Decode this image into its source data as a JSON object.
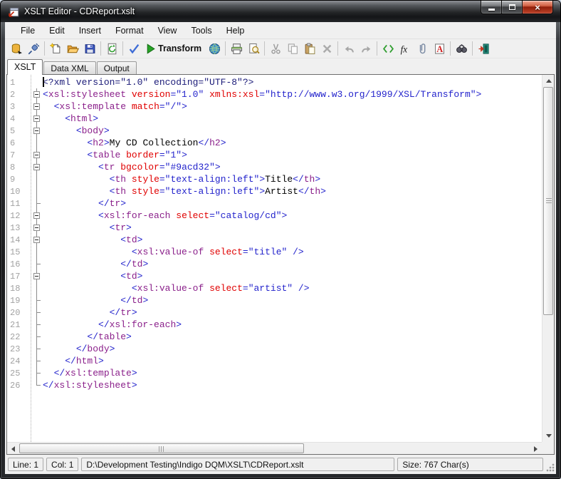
{
  "window": {
    "title": "XSLT Editor - CDReport.xslt"
  },
  "titlebar_buttons": [
    "minimize",
    "maximize",
    "close"
  ],
  "menu": {
    "items": [
      "File",
      "Edit",
      "Insert",
      "Format",
      "View",
      "Tools",
      "Help"
    ]
  },
  "toolbar": {
    "groups": [
      [
        {
          "name": "database-export"
        },
        {
          "name": "connect"
        }
      ],
      [
        {
          "name": "new-document"
        },
        {
          "name": "open-folder"
        },
        {
          "name": "save"
        }
      ],
      [
        {
          "name": "refresh"
        }
      ],
      [
        {
          "name": "validate"
        },
        {
          "name": "transform",
          "label": "Transform"
        },
        {
          "name": "browser-globe"
        }
      ],
      [
        {
          "name": "print"
        },
        {
          "name": "print-preview"
        }
      ],
      [
        {
          "name": "cut",
          "disabled": true
        },
        {
          "name": "copy",
          "disabled": true
        },
        {
          "name": "paste"
        },
        {
          "name": "delete",
          "disabled": true
        }
      ],
      [
        {
          "name": "undo",
          "disabled": true
        },
        {
          "name": "redo",
          "disabled": true
        }
      ],
      [
        {
          "name": "code-tags"
        },
        {
          "name": "function"
        },
        {
          "name": "attachment"
        },
        {
          "name": "font"
        }
      ],
      [
        {
          "name": "find"
        }
      ],
      [
        {
          "name": "exit"
        }
      ]
    ]
  },
  "tabs": [
    {
      "label": "XSLT",
      "active": true
    },
    {
      "label": "Data XML",
      "active": false
    },
    {
      "label": "Output",
      "active": false
    }
  ],
  "colors": {
    "i": "#1b1b78",
    "d": "#2323cc",
    "t": "#8a1f8a",
    "a": "#e00000",
    "v": "#2323cc",
    "x": "#000000"
  },
  "editor": {
    "lines": [
      {
        "n": 1,
        "f": "",
        "s": [
          [
            "<?xml version=\"1.0\" encoding=\"UTF-8\"?>",
            "i"
          ]
        ]
      },
      {
        "n": 2,
        "f": "b",
        "s": [
          [
            "<",
            "d"
          ],
          [
            "xsl:stylesheet",
            "t"
          ],
          [
            " ",
            "x"
          ],
          [
            "version",
            "a"
          ],
          [
            "=\"1.0\"",
            "v"
          ],
          [
            " ",
            "x"
          ],
          [
            "xmlns:xsl",
            "a"
          ],
          [
            "=\"http://www.w3.org/1999/XSL/Transform\"",
            "v"
          ],
          [
            ">",
            "d"
          ]
        ]
      },
      {
        "n": 3,
        "f": "b",
        "s": [
          [
            "  ",
            "x"
          ],
          [
            "<",
            "d"
          ],
          [
            "xsl:template",
            "t"
          ],
          [
            " ",
            "x"
          ],
          [
            "match",
            "a"
          ],
          [
            "=\"/\"",
            "v"
          ],
          [
            ">",
            "d"
          ]
        ]
      },
      {
        "n": 4,
        "f": "b",
        "s": [
          [
            "    ",
            "x"
          ],
          [
            "<",
            "d"
          ],
          [
            "html",
            "t"
          ],
          [
            ">",
            "d"
          ]
        ]
      },
      {
        "n": 5,
        "f": "b",
        "s": [
          [
            "      ",
            "x"
          ],
          [
            "<",
            "d"
          ],
          [
            "body",
            "t"
          ],
          [
            ">",
            "d"
          ]
        ]
      },
      {
        "n": 6,
        "f": "",
        "s": [
          [
            "        ",
            "x"
          ],
          [
            "<",
            "d"
          ],
          [
            "h2",
            "t"
          ],
          [
            ">",
            "d"
          ],
          [
            "My CD Collection",
            "x"
          ],
          [
            "</",
            "d"
          ],
          [
            "h2",
            "t"
          ],
          [
            ">",
            "d"
          ]
        ]
      },
      {
        "n": 7,
        "f": "b",
        "s": [
          [
            "        ",
            "x"
          ],
          [
            "<",
            "d"
          ],
          [
            "table",
            "t"
          ],
          [
            " ",
            "x"
          ],
          [
            "border",
            "a"
          ],
          [
            "=\"1\"",
            "v"
          ],
          [
            ">",
            "d"
          ]
        ]
      },
      {
        "n": 8,
        "f": "b",
        "s": [
          [
            "          ",
            "x"
          ],
          [
            "<",
            "d"
          ],
          [
            "tr",
            "t"
          ],
          [
            " ",
            "x"
          ],
          [
            "bgcolor",
            "a"
          ],
          [
            "=\"#9acd32\"",
            "v"
          ],
          [
            ">",
            "d"
          ]
        ]
      },
      {
        "n": 9,
        "f": "",
        "s": [
          [
            "            ",
            "x"
          ],
          [
            "<",
            "d"
          ],
          [
            "th",
            "t"
          ],
          [
            " ",
            "x"
          ],
          [
            "style",
            "a"
          ],
          [
            "=\"text-align:left\"",
            "v"
          ],
          [
            ">",
            "d"
          ],
          [
            "Title",
            "x"
          ],
          [
            "</",
            "d"
          ],
          [
            "th",
            "t"
          ],
          [
            ">",
            "d"
          ]
        ]
      },
      {
        "n": 10,
        "f": "",
        "s": [
          [
            "            ",
            "x"
          ],
          [
            "<",
            "d"
          ],
          [
            "th",
            "t"
          ],
          [
            " ",
            "x"
          ],
          [
            "style",
            "a"
          ],
          [
            "=\"text-align:left\"",
            "v"
          ],
          [
            ">",
            "d"
          ],
          [
            "Artist",
            "x"
          ],
          [
            "</",
            "d"
          ],
          [
            "th",
            "t"
          ],
          [
            ">",
            "d"
          ]
        ]
      },
      {
        "n": 11,
        "f": "t",
        "s": [
          [
            "          ",
            "x"
          ],
          [
            "</",
            "d"
          ],
          [
            "tr",
            "t"
          ],
          [
            ">",
            "d"
          ]
        ]
      },
      {
        "n": 12,
        "f": "b",
        "s": [
          [
            "          ",
            "x"
          ],
          [
            "<",
            "d"
          ],
          [
            "xsl:for-each",
            "t"
          ],
          [
            " ",
            "x"
          ],
          [
            "select",
            "a"
          ],
          [
            "=\"catalog/cd\"",
            "v"
          ],
          [
            ">",
            "d"
          ]
        ]
      },
      {
        "n": 13,
        "f": "b",
        "s": [
          [
            "            ",
            "x"
          ],
          [
            "<",
            "d"
          ],
          [
            "tr",
            "t"
          ],
          [
            ">",
            "d"
          ]
        ]
      },
      {
        "n": 14,
        "f": "b",
        "s": [
          [
            "              ",
            "x"
          ],
          [
            "<",
            "d"
          ],
          [
            "td",
            "t"
          ],
          [
            ">",
            "d"
          ]
        ]
      },
      {
        "n": 15,
        "f": "",
        "s": [
          [
            "                ",
            "x"
          ],
          [
            "<",
            "d"
          ],
          [
            "xsl:value-of",
            "t"
          ],
          [
            " ",
            "x"
          ],
          [
            "select",
            "a"
          ],
          [
            "=\"title\"",
            "v"
          ],
          [
            " ",
            "x"
          ],
          [
            "/>",
            "d"
          ]
        ]
      },
      {
        "n": 16,
        "f": "t",
        "s": [
          [
            "              ",
            "x"
          ],
          [
            "</",
            "d"
          ],
          [
            "td",
            "t"
          ],
          [
            ">",
            "d"
          ]
        ]
      },
      {
        "n": 17,
        "f": "b",
        "s": [
          [
            "              ",
            "x"
          ],
          [
            "<",
            "d"
          ],
          [
            "td",
            "t"
          ],
          [
            ">",
            "d"
          ]
        ]
      },
      {
        "n": 18,
        "f": "",
        "s": [
          [
            "                ",
            "x"
          ],
          [
            "<",
            "d"
          ],
          [
            "xsl:value-of",
            "t"
          ],
          [
            " ",
            "x"
          ],
          [
            "select",
            "a"
          ],
          [
            "=\"artist\"",
            "v"
          ],
          [
            " ",
            "x"
          ],
          [
            "/>",
            "d"
          ]
        ]
      },
      {
        "n": 19,
        "f": "t",
        "s": [
          [
            "              ",
            "x"
          ],
          [
            "</",
            "d"
          ],
          [
            "td",
            "t"
          ],
          [
            ">",
            "d"
          ]
        ]
      },
      {
        "n": 20,
        "f": "t",
        "s": [
          [
            "            ",
            "x"
          ],
          [
            "</",
            "d"
          ],
          [
            "tr",
            "t"
          ],
          [
            ">",
            "d"
          ]
        ]
      },
      {
        "n": 21,
        "f": "t",
        "s": [
          [
            "          ",
            "x"
          ],
          [
            "</",
            "d"
          ],
          [
            "xsl:for-each",
            "t"
          ],
          [
            ">",
            "d"
          ]
        ]
      },
      {
        "n": 22,
        "f": "t",
        "s": [
          [
            "        ",
            "x"
          ],
          [
            "</",
            "d"
          ],
          [
            "table",
            "t"
          ],
          [
            ">",
            "d"
          ]
        ]
      },
      {
        "n": 23,
        "f": "t",
        "s": [
          [
            "      ",
            "x"
          ],
          [
            "</",
            "d"
          ],
          [
            "body",
            "t"
          ],
          [
            ">",
            "d"
          ]
        ]
      },
      {
        "n": 24,
        "f": "t",
        "s": [
          [
            "    ",
            "x"
          ],
          [
            "</",
            "d"
          ],
          [
            "html",
            "t"
          ],
          [
            ">",
            "d"
          ]
        ]
      },
      {
        "n": 25,
        "f": "t",
        "s": [
          [
            "  ",
            "x"
          ],
          [
            "</",
            "d"
          ],
          [
            "xsl:template",
            "t"
          ],
          [
            ">",
            "d"
          ]
        ]
      },
      {
        "n": 26,
        "f": "c",
        "s": [
          [
            "</",
            "d"
          ],
          [
            "xsl:stylesheet",
            "t"
          ],
          [
            ">",
            "d"
          ]
        ]
      }
    ]
  },
  "statusbar": {
    "line": "Line: 1",
    "col": "Col: 1",
    "path": "D:\\Development Testing\\Indigo DQM\\XSLT\\CDReport.xslt",
    "size": "Size: 767 Char(s)"
  }
}
